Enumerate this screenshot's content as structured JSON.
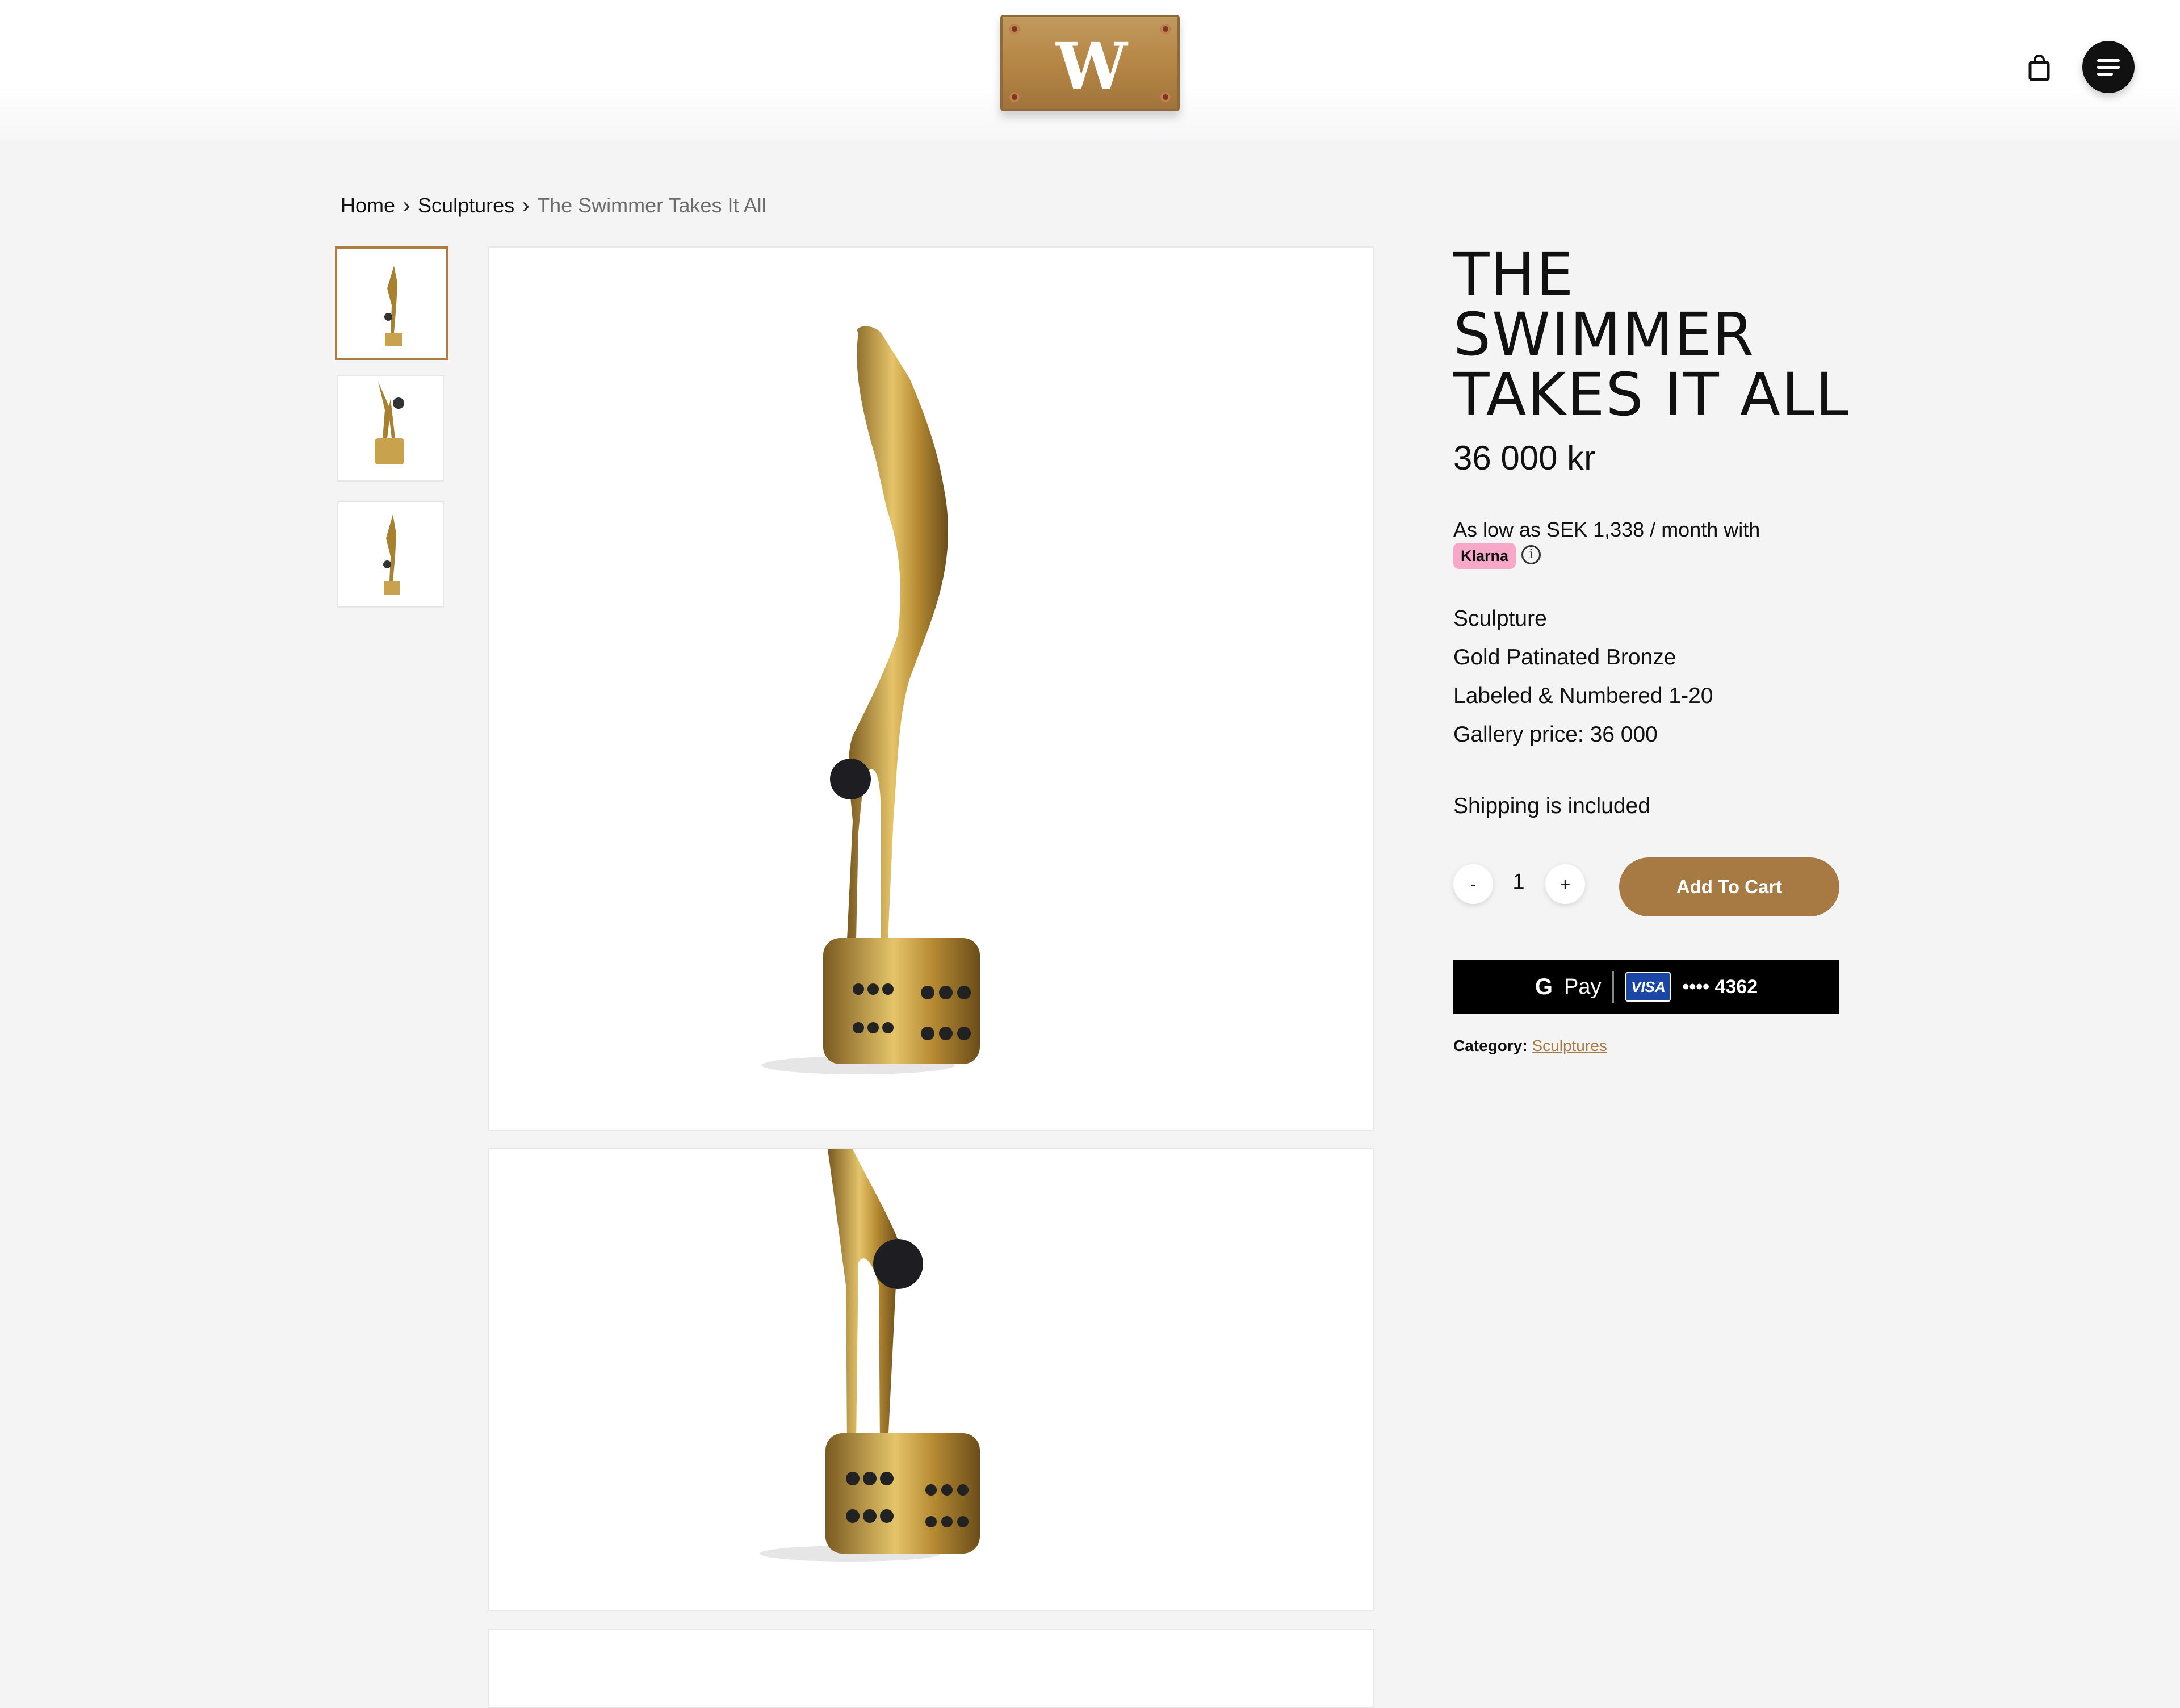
{
  "header": {
    "logo_letter": "W",
    "cart_icon": "shopping-bag-icon",
    "menu_icon": "hamburger-menu-icon"
  },
  "breadcrumb": {
    "items": [
      "Home",
      "Sculptures"
    ],
    "current": "The Swimmer Takes It All"
  },
  "product": {
    "title": "THE SWIMMER TAKES IT ALL",
    "price": "36 000 kr",
    "klarna": {
      "text": "As low as SEK 1,338 / month with",
      "badge": "Klarna",
      "info_icon": "info-icon"
    },
    "details": [
      "Sculpture",
      "Gold Patinated Bronze",
      "Labeled & Numbered 1-20",
      "Gallery price: 36 000"
    ],
    "shipping": "Shipping is included",
    "quantity": {
      "minus": "-",
      "value": "1",
      "plus": "+"
    },
    "add_to_cart": "Add To Cart",
    "gpay": {
      "g": "G",
      "pay": "Pay",
      "card_brand": "VISA",
      "card": "•••• 4362"
    },
    "category_label": "Category:",
    "category_value": "Sculptures"
  },
  "colors": {
    "accent": "#a87a43",
    "klarna_pink": "#f7a8c8",
    "gold": "#c9a24e"
  }
}
